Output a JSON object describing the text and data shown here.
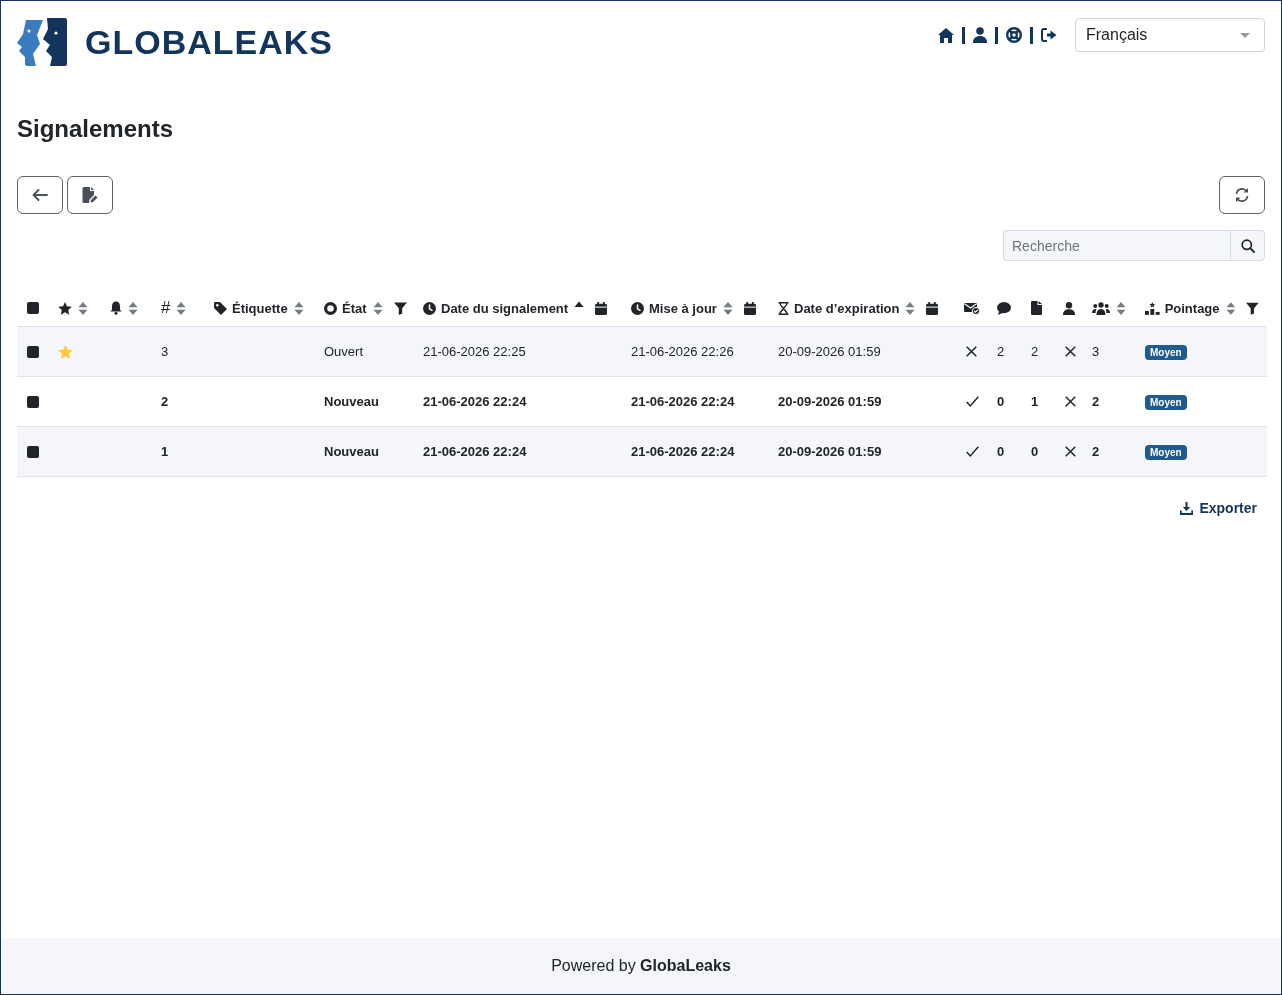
{
  "header": {
    "logo_text": "GLOBALEAKS",
    "language": "Français"
  },
  "page_title": "Signalements",
  "search": {
    "placeholder": "Recherche"
  },
  "table": {
    "columns": [
      {
        "kind": "checkbox",
        "checked": false
      },
      {
        "kind": "star",
        "sortable": true,
        "sorted_ascending": false
      },
      {
        "kind": "bell",
        "sortable": true,
        "sorted_ascending": false
      },
      {
        "kind": "plain",
        "label": "#",
        "sortable": true,
        "sorted_ascending": false
      },
      {
        "kind": "tag",
        "label": "Étiquette",
        "sortable": true,
        "sorted_ascending": false
      },
      {
        "kind": "circle",
        "label": "État",
        "sortable": true,
        "sorted_ascending": false,
        "filter": true
      },
      {
        "kind": "clock",
        "label": "Date du signalement",
        "sortable": true,
        "sorted_ascending": true,
        "date_filter": true
      },
      {
        "kind": "clock",
        "label": "Mise à jour",
        "sortable": true,
        "sorted_ascending": false,
        "date_filter": true
      },
      {
        "kind": "hourglass",
        "label": "Date d’expiration",
        "sortable": true,
        "sorted_ascending": false,
        "date_filter": true
      },
      {
        "kind": "envelope"
      },
      {
        "kind": "comment"
      },
      {
        "kind": "file"
      },
      {
        "kind": "user"
      },
      {
        "kind": "users",
        "sortable": true,
        "sorted_ascending": false
      },
      {
        "kind": "chart",
        "label": "Pointage",
        "sortable": true,
        "sorted_ascending": false,
        "filter": true
      }
    ],
    "rows": [
      {
        "checked": false,
        "starred": true,
        "unread": false,
        "number": "3",
        "status": "Ouvert",
        "submitted": "21-06-2026 22:25",
        "updated": "21-06-2026 22:26",
        "expires": "20-09-2026 01:59",
        "envelope": false,
        "comments": "2",
        "files": "2",
        "user": false,
        "users": "3",
        "score": "Moyen"
      },
      {
        "checked": false,
        "starred": false,
        "unread": true,
        "number": "2",
        "status": "Nouveau",
        "submitted": "21-06-2026 22:24",
        "updated": "21-06-2026 22:24",
        "expires": "20-09-2026 01:59",
        "envelope": true,
        "comments": "0",
        "files": "1",
        "user": false,
        "users": "2",
        "score": "Moyen"
      },
      {
        "checked": false,
        "starred": false,
        "unread": true,
        "number": "1",
        "status": "Nouveau",
        "submitted": "21-06-2026 22:24",
        "updated": "21-06-2026 22:24",
        "expires": "20-09-2026 01:59",
        "envelope": true,
        "comments": "0",
        "files": "0",
        "user": false,
        "users": "2",
        "score": "Moyen"
      }
    ]
  },
  "export_label": "Exporter",
  "footer": "Powered by **GlobaLeaks**"
}
